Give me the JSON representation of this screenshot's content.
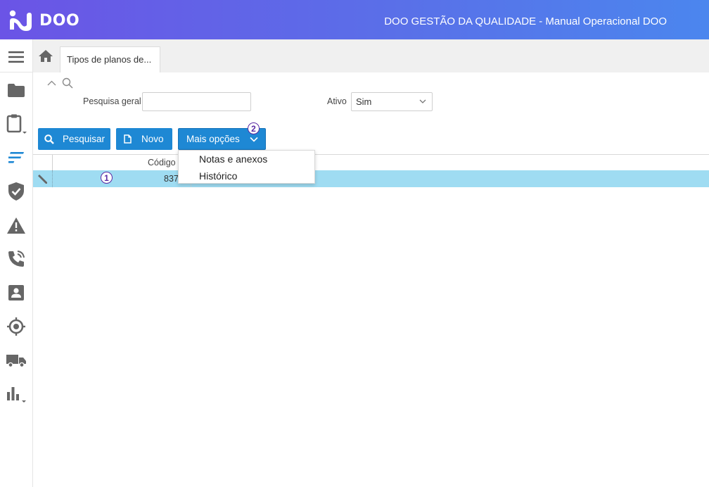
{
  "header": {
    "logo_text": "DOO",
    "app_title": "DOO GESTÃO DA QUALIDADE - Manual Operacional DOO",
    "gradient": [
      "#6b54e6",
      "#4b86ee"
    ]
  },
  "sidebar": {
    "items": [
      {
        "icon": "hamburger-menu-icon"
      },
      {
        "icon": "folder-icon"
      },
      {
        "icon": "clipboard-icon"
      },
      {
        "icon": "list-lines-icon",
        "active": true
      },
      {
        "icon": "shield-check-icon"
      },
      {
        "icon": "warning-icon"
      },
      {
        "icon": "phone-icon"
      },
      {
        "icon": "contact-card-icon"
      },
      {
        "icon": "target-icon"
      },
      {
        "icon": "truck-icon"
      },
      {
        "icon": "bar-chart-icon"
      }
    ],
    "active_color": "#1e88d4"
  },
  "tabs": [
    {
      "label": "Tipos de planos de..."
    }
  ],
  "filters": {
    "search_label": "Pesquisa geral",
    "search_value": "",
    "active_label": "Ativo",
    "active_value": "Sim"
  },
  "toolbar": {
    "search_button": "Pesquisar",
    "new_button": "Novo",
    "more_button": "Mais opções",
    "accent": "#1e88d4"
  },
  "more_menu": {
    "items": [
      "Notas e anexos",
      "Histórico"
    ]
  },
  "grid": {
    "columns": [
      "Código"
    ],
    "rows": [
      {
        "code": "837",
        "selected": true
      }
    ],
    "selected_color": "#9fdcf2"
  },
  "badges": [
    "1",
    "2"
  ]
}
